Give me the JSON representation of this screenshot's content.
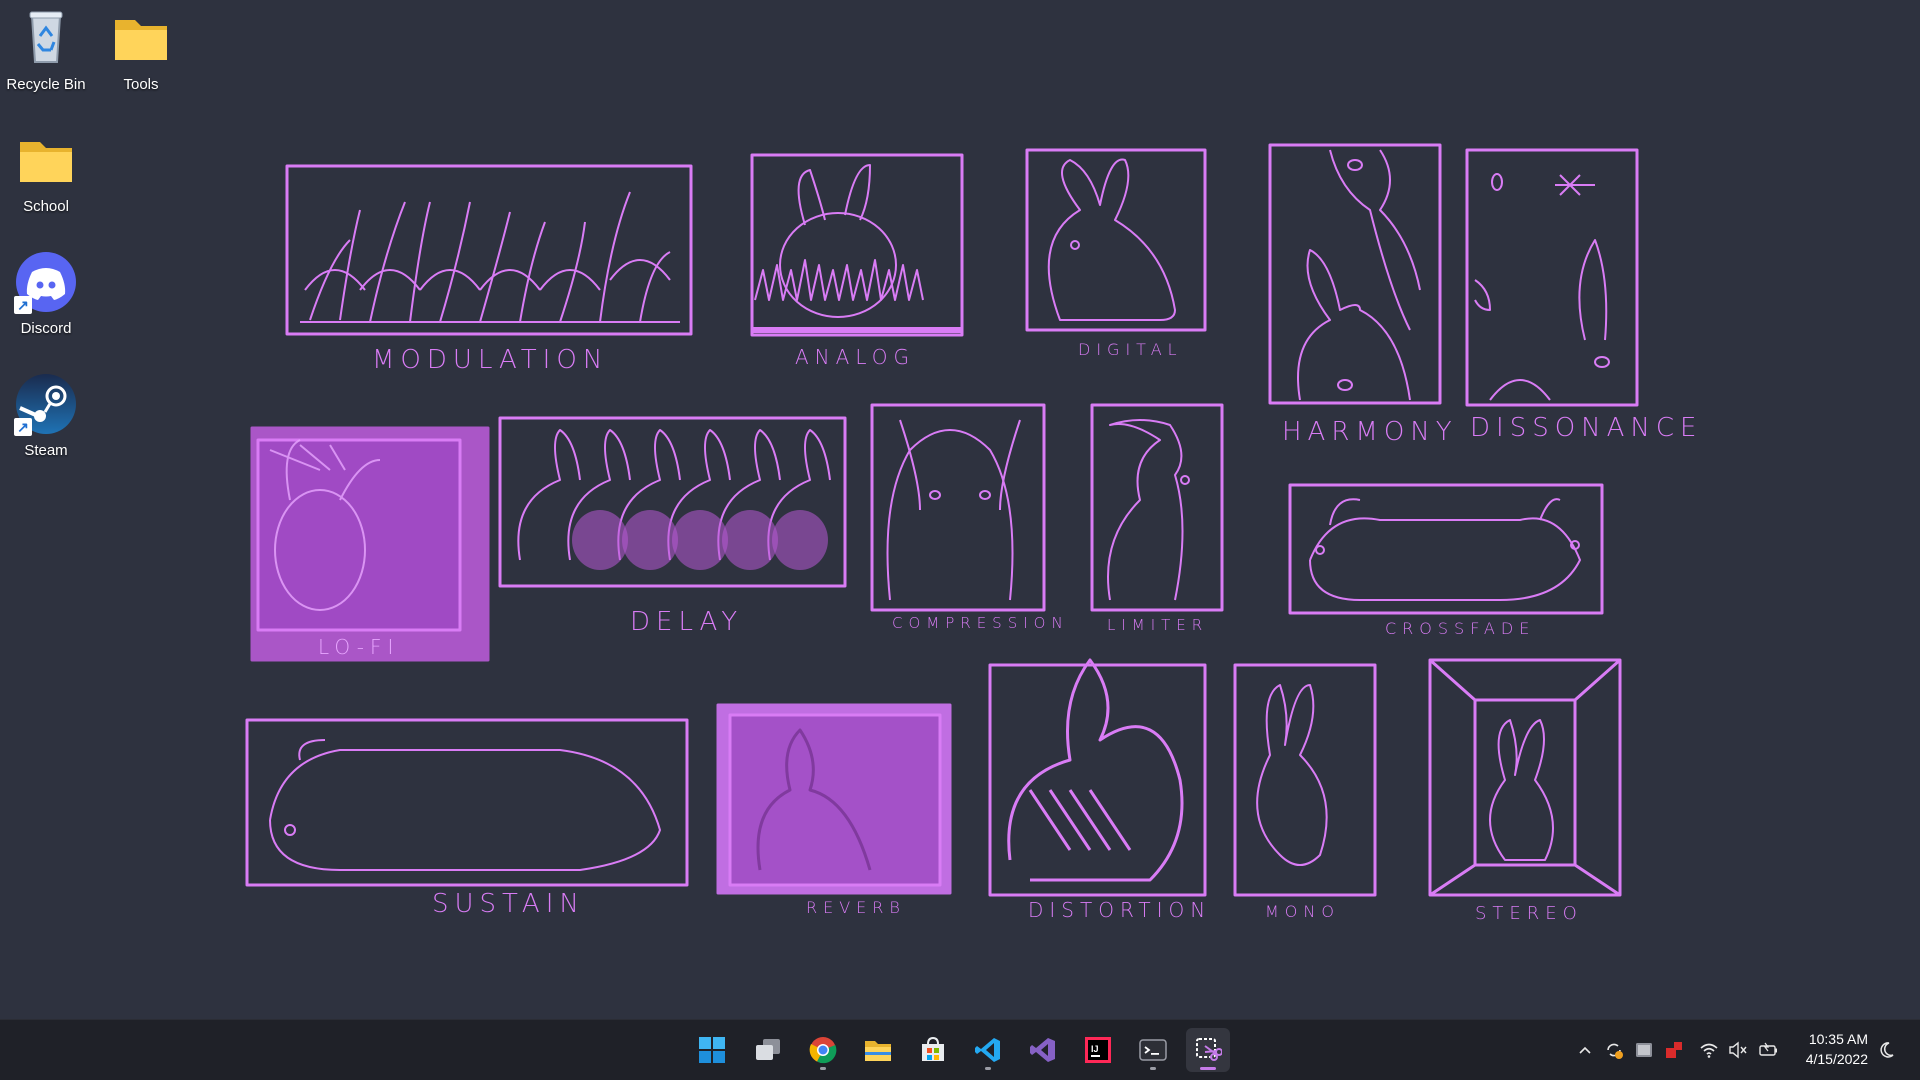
{
  "desktop": {
    "icons": [
      {
        "label": "Recycle Bin",
        "icon": "recycle-bin-icon"
      },
      {
        "label": "Tools",
        "icon": "folder-icon"
      },
      {
        "label": "School",
        "icon": "folder-icon"
      },
      {
        "label": "Discord",
        "icon": "discord-icon"
      },
      {
        "label": "Steam",
        "icon": "steam-icon"
      }
    ]
  },
  "wallpaper": {
    "labels": {
      "modulation": "MODULATION",
      "analog": "ANALOG",
      "digital": "DIGITAL",
      "harmony": "HARMONY",
      "dissonance": "DISSONANCE",
      "lofi": "LO-FI",
      "delay": "DELAY",
      "compression": "COMPRESSION",
      "limiter": "LIMITER",
      "crossfade": "CROSSFADE",
      "sustain": "SUSTAIN",
      "reverb": "REVERB",
      "distortion": "DISTORTION",
      "mono": "MONO",
      "stereo": "STEREO"
    },
    "accent_color": "#d97cf5"
  },
  "taskbar": {
    "apps": [
      {
        "name": "start-icon"
      },
      {
        "name": "task-view-icon"
      },
      {
        "name": "chrome-icon"
      },
      {
        "name": "file-explorer-icon"
      },
      {
        "name": "microsoft-store-icon"
      },
      {
        "name": "vscode-icon"
      },
      {
        "name": "visual-studio-icon"
      },
      {
        "name": "jetbrains-icon"
      },
      {
        "name": "terminal-icon"
      },
      {
        "name": "snipping-tool-icon"
      }
    ],
    "tray_icons": [
      "chevron-up-icon",
      "sync-icon",
      "tablet-icon",
      "security-icon",
      "wifi-icon",
      "speaker-muted-icon",
      "battery-icon"
    ],
    "clock": {
      "time": "10:35 AM",
      "date": "4/15/2022"
    }
  }
}
